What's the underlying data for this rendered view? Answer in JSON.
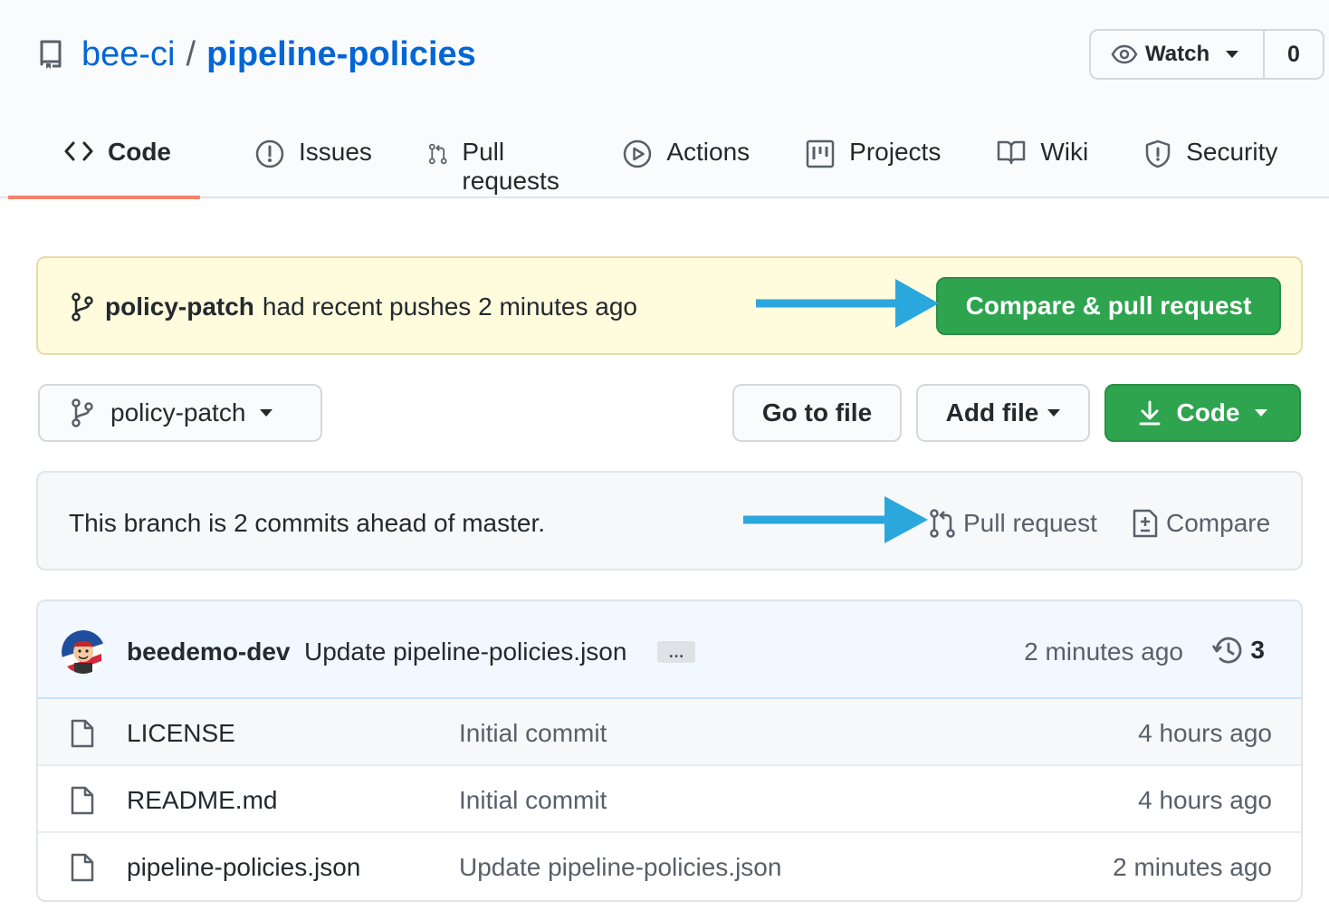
{
  "repo": {
    "owner": "bee-ci",
    "separator": "/",
    "name": "pipeline-policies"
  },
  "watch": {
    "label": "Watch",
    "count": "0"
  },
  "tabs": [
    {
      "label": "Code",
      "icon": "code-icon",
      "active": true
    },
    {
      "label": "Issues",
      "icon": "issue-icon"
    },
    {
      "label": "Pull requests",
      "icon": "pull-request-icon"
    },
    {
      "label": "Actions",
      "icon": "play-icon"
    },
    {
      "label": "Projects",
      "icon": "project-icon"
    },
    {
      "label": "Wiki",
      "icon": "book-icon"
    },
    {
      "label": "Security",
      "icon": "shield-icon"
    }
  ],
  "flash": {
    "branch": "policy-patch",
    "message": "had recent pushes 2 minutes ago",
    "button": "Compare & pull request"
  },
  "toolbar": {
    "branch": "policy-patch",
    "goto_file": "Go to file",
    "add_file": "Add file",
    "code": "Code"
  },
  "ahead": {
    "text": "This branch is 2 commits ahead of master.",
    "pull_request": "Pull request",
    "compare": "Compare"
  },
  "latest_commit": {
    "author": "beedemo-dev",
    "message": "Update pipeline-policies.json",
    "ellipsis": "…",
    "time": "2 minutes ago",
    "commit_count": "3"
  },
  "files": [
    {
      "name": "LICENSE",
      "message": "Initial commit",
      "time": "4 hours ago"
    },
    {
      "name": "README.md",
      "message": "Initial commit",
      "time": "4 hours ago"
    },
    {
      "name": "pipeline-policies.json",
      "message": "Update pipeline-policies.json",
      "time": "2 minutes ago"
    }
  ],
  "colors": {
    "link": "#0366d6",
    "primary_button": "#2ea44f",
    "active_tab_underline": "#f9826c",
    "flash_background": "#fffbdd",
    "annotation_arrow": "#2aa7dc"
  }
}
